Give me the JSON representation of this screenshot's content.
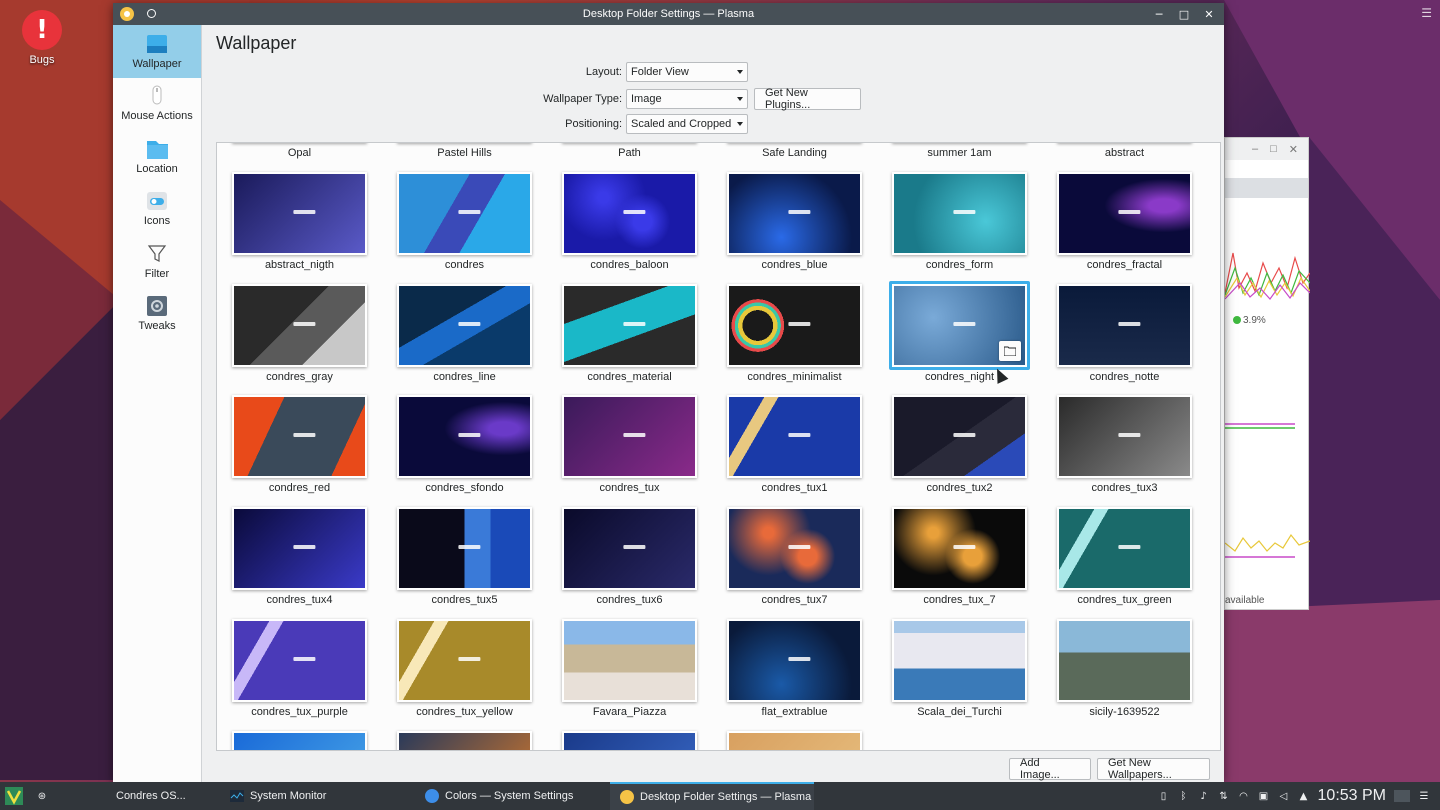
{
  "desktop": {
    "icon_label": "Bugs"
  },
  "window": {
    "title": "Desktop Folder Settings — Plasma"
  },
  "sidebar": {
    "items": [
      {
        "label": "Wallpaper",
        "icon": "wallpaper-icon"
      },
      {
        "label": "Mouse Actions",
        "icon": "mouse-icon"
      },
      {
        "label": "Location",
        "icon": "folder-icon"
      },
      {
        "label": "Icons",
        "icon": "toggle-icon"
      },
      {
        "label": "Filter",
        "icon": "filter-icon"
      },
      {
        "label": "Tweaks",
        "icon": "gear-icon"
      }
    ]
  },
  "page": {
    "title": "Wallpaper",
    "layout_label": "Layout:",
    "layout_value": "Folder View",
    "type_label": "Wallpaper Type:",
    "type_value": "Image",
    "get_plugins": "Get New Plugins...",
    "positioning_label": "Positioning:",
    "positioning_value": "Scaled and Cropped",
    "add_image": "Add Image...",
    "get_wallpapers": "Get New Wallpapers..."
  },
  "wallpapers": [
    {
      "name": "Opal",
      "colors": [
        "#6a3d8f",
        "#c44d7a"
      ],
      "style": "partial"
    },
    {
      "name": "Pastel Hills",
      "colors": [
        "#d8b8d8",
        "#a8c8e8"
      ],
      "style": "partial"
    },
    {
      "name": "Path",
      "colors": [
        "#2a2a2a",
        "#6b4a2a"
      ],
      "style": "partial"
    },
    {
      "name": "Safe Landing",
      "colors": [
        "#e8a060",
        "#3a5a8a"
      ],
      "style": "partial"
    },
    {
      "name": "summer 1am",
      "colors": [
        "#3a3a6a",
        "#8a7ac8"
      ],
      "style": "partial"
    },
    {
      "name": "abstract",
      "colors": [
        "#1a2a4a",
        "#4a6a9a"
      ],
      "style": "partial"
    },
    {
      "name": "abstract_nigth",
      "colors": [
        "#1a1a5a",
        "#5a5ac8"
      ],
      "style": "wave"
    },
    {
      "name": "condres",
      "colors": [
        "#2d8fd8",
        "#1a6ab8"
      ],
      "style": "material-blue"
    },
    {
      "name": "condres_baloon",
      "colors": [
        "#1a1aa8",
        "#3a3ae8"
      ],
      "style": "bokeh"
    },
    {
      "name": "condres_blue",
      "colors": [
        "#0a1a4a",
        "#2a6ae8"
      ],
      "style": "glow"
    },
    {
      "name": "condres_form",
      "colors": [
        "#1a7a8a",
        "#4ac8d8"
      ],
      "style": "form"
    },
    {
      "name": "condres_fractal",
      "colors": [
        "#0a0a3a",
        "#8a3ac8"
      ],
      "style": "fractal"
    },
    {
      "name": "condres_gray",
      "colors": [
        "#3a3a3a",
        "#6a6a6a"
      ],
      "style": "gray"
    },
    {
      "name": "condres_line",
      "colors": [
        "#0a3a6a",
        "#1a7ad8"
      ],
      "style": "line"
    },
    {
      "name": "condres_material",
      "colors": [
        "#2a2a2a",
        "#1ab8c8"
      ],
      "style": "material"
    },
    {
      "name": "condres_minimalist",
      "colors": [
        "#1a1a1a",
        "#e8c83a"
      ],
      "style": "minimalist"
    },
    {
      "name": "condres_night",
      "colors": [
        "#2a5a8a",
        "#7aaad8"
      ],
      "style": "night"
    },
    {
      "name": "condres_notte",
      "colors": [
        "#0a1a3a",
        "#1a2a4a"
      ],
      "style": "notte"
    },
    {
      "name": "condres_red",
      "colors": [
        "#e84a1a",
        "#3a4a5a"
      ],
      "style": "red"
    },
    {
      "name": "condres_sfondo",
      "colors": [
        "#0a0a3a",
        "#6a3ac8"
      ],
      "style": "fractal"
    },
    {
      "name": "condres_tux",
      "colors": [
        "#3a1a5a",
        "#8a2a8a"
      ],
      "style": "tux"
    },
    {
      "name": "condres_tux1",
      "colors": [
        "#1a3aa8",
        "#e8c880"
      ],
      "style": "hex-blue"
    },
    {
      "name": "condres_tux2",
      "colors": [
        "#1a1a2a",
        "#2a4ab8"
      ],
      "style": "tux2"
    },
    {
      "name": "condres_tux3",
      "colors": [
        "#2a2a2a",
        "#8a8a8a"
      ],
      "style": "swirl"
    },
    {
      "name": "condres_tux4",
      "colors": [
        "#0a0a3a",
        "#3a3ac8"
      ],
      "style": "tux4"
    },
    {
      "name": "condres_tux5",
      "colors": [
        "#0a0a1a",
        "#3a7ad8"
      ],
      "style": "chevron"
    },
    {
      "name": "condres_tux6",
      "colors": [
        "#0a0a2a",
        "#2a2a6a"
      ],
      "style": "tux6"
    },
    {
      "name": "condres_tux7",
      "colors": [
        "#1a2a5a",
        "#e86a3a"
      ],
      "style": "bokeh2"
    },
    {
      "name": "condres_tux_7",
      "colors": [
        "#0a0a0a",
        "#e8a03a"
      ],
      "style": "bokeh3"
    },
    {
      "name": "condres_tux_green",
      "colors": [
        "#1a6a6a",
        "#a8e8e8"
      ],
      "style": "hex-green"
    },
    {
      "name": "condres_tux_purple",
      "colors": [
        "#4a3ab8",
        "#c8b8f8"
      ],
      "style": "hex-purple"
    },
    {
      "name": "condres_tux_yellow",
      "colors": [
        "#a88a2a",
        "#f8e8b8"
      ],
      "style": "hex-yellow"
    },
    {
      "name": "Favara_Piazza",
      "colors": [
        "#8ab8e8",
        "#c8b8a0"
      ],
      "style": "photo-piazza"
    },
    {
      "name": "flat_extrablue",
      "colors": [
        "#0a1a3a",
        "#1a5aa8"
      ],
      "style": "extrablue"
    },
    {
      "name": "Scala_dei_Turchi",
      "colors": [
        "#e8e8f0",
        "#3a7ab8"
      ],
      "style": "photo-scala"
    },
    {
      "name": "sicily-1639522",
      "colors": [
        "#8ab8d8",
        "#5a6a5a"
      ],
      "style": "photo-sicily"
    },
    {
      "name": "",
      "colors": [
        "#1a6ad8",
        "#4aa8e8"
      ],
      "style": "partial-bottom"
    },
    {
      "name": "",
      "colors": [
        "#2a3a5a",
        "#d87a2a"
      ],
      "style": "partial-bottom"
    },
    {
      "name": "",
      "colors": [
        "#1a3a8a",
        "#3a6ac8"
      ],
      "style": "partial-bottom"
    },
    {
      "name": "",
      "colors": [
        "#d8a060",
        "#e8c080"
      ],
      "style": "partial-bottom"
    }
  ],
  "selected_wallpaper": "condres_night",
  "background_window": {
    "usage": "3.9%",
    "available": "available"
  },
  "taskbar": {
    "tasks": [
      {
        "label": "Condres OS..."
      },
      {
        "label": "System Monitor"
      },
      {
        "label": "Colors — System Settings"
      },
      {
        "label": "Desktop Folder Settings — Plasma"
      }
    ],
    "clock": "10:53 PM"
  }
}
